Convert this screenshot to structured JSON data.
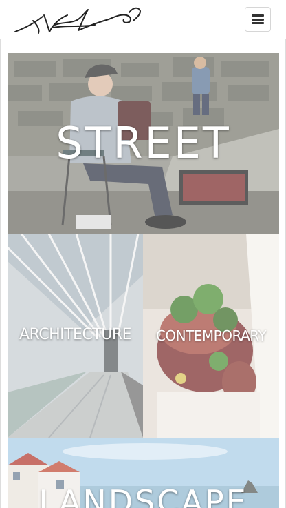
{
  "header": {
    "logo_alt": "signature logo",
    "menu_icon": "hamburger-menu-icon"
  },
  "gallery": {
    "tiles": [
      {
        "id": "street",
        "label": "STREET"
      },
      {
        "id": "architecture",
        "label": "ARCHITECTURE"
      },
      {
        "id": "contemporary",
        "label": "CONTEMPORARY"
      },
      {
        "id": "landscape",
        "label": "LANDSCAPE"
      }
    ]
  },
  "colors": {
    "caption": "#ffffff",
    "border": "#e7e7e7",
    "icon": "#333333"
  }
}
